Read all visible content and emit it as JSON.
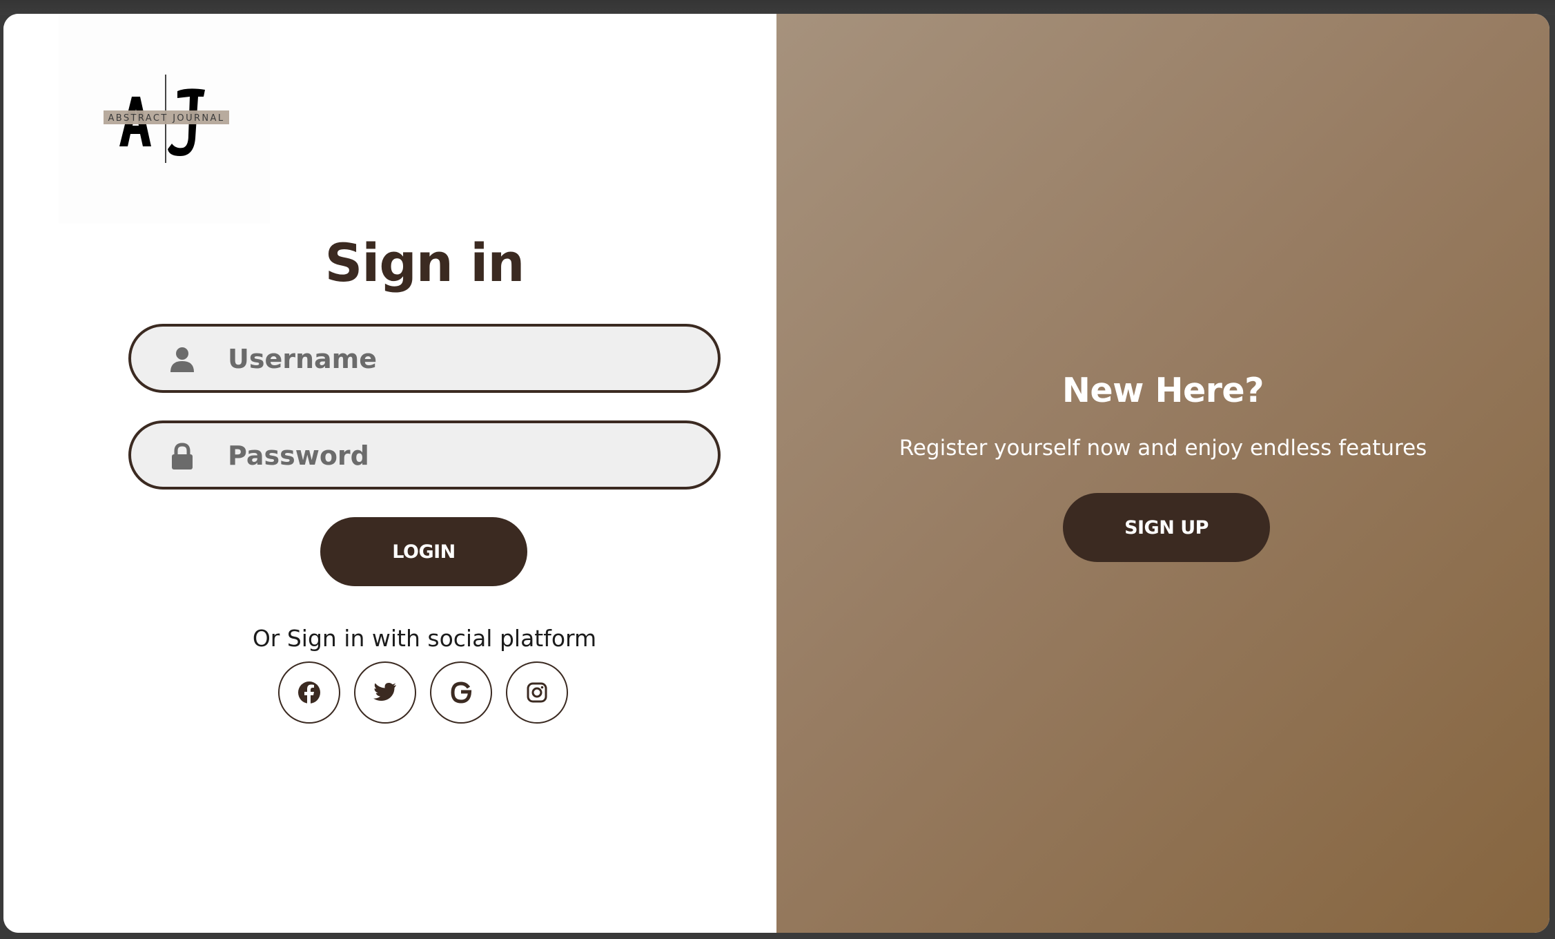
{
  "logo": {
    "initials_left": "A",
    "initials_right": "J",
    "brand_text": "ABSTRACT JOURNAL"
  },
  "signin": {
    "title": "Sign in",
    "username_placeholder": "Username",
    "password_placeholder": "Password",
    "login_label": "LOGIN",
    "social_text": "Or Sign in with social platform",
    "socials": [
      "facebook-icon",
      "twitter-icon",
      "google-icon",
      "instagram-icon"
    ]
  },
  "signup_panel": {
    "heading": "New Here?",
    "subtext": "Register yourself now and enjoy endless features",
    "signup_label": "SIGN UP"
  },
  "colors": {
    "accent": "#3b2a21",
    "panel_gradient_start": "#a6927d",
    "panel_gradient_end": "#86653f",
    "input_bg": "#efefef"
  }
}
